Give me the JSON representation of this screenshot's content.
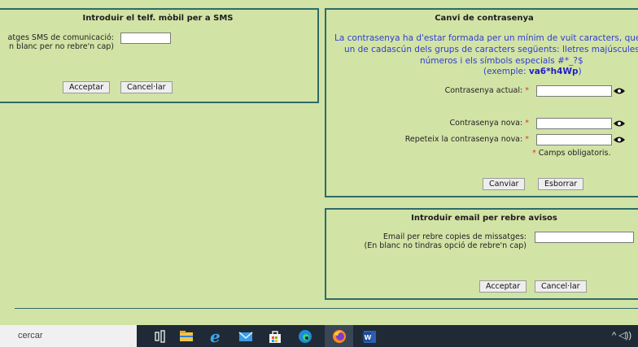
{
  "sms": {
    "title": "Introduir el telf. mòbil per a SMS",
    "field_label_line1": "atges SMS de comunicació:",
    "field_label_line2": "n blanc per no rebre'n cap)",
    "field_value": "",
    "accept_label": "Acceptar",
    "cancel_label": "Cancel·lar"
  },
  "password": {
    "title": "Canvi de contrasenya",
    "info_line1": "La contrasenya ha d'estar formada per un mínim de vuit caracters, que co",
    "info_line2": "un de cadascún dels grups de caracters següents: lletres majúscules,",
    "info_line3": "números i els símbols especials #*_?$",
    "info_example_prefix": "(exemple: ",
    "info_example_value": "va6*h4Wp",
    "info_example_suffix": ")",
    "current_label": "Contrasenya actual:",
    "new_label": "Contrasenya nova:",
    "repeat_label": "Repeteix la contrasenya nova:",
    "required_marker": "*",
    "required_note": "Camps obligatoris.",
    "change_label": "Canviar",
    "clear_label": "Esborrar"
  },
  "email": {
    "title": "Introduir email per rebre avisos",
    "field_label_line1": "Email per rebre copies de missatges:",
    "field_label_line2": "(En blanc no tindras opció de rebre'n cap)",
    "field_value": "",
    "accept_label": "Acceptar",
    "cancel_label": "Cancel·lar"
  },
  "taskbar": {
    "search_text": "cercar",
    "icons": [
      "task-view-icon",
      "file-explorer-icon",
      "edge-legacy-icon",
      "mail-icon",
      "store-icon",
      "edge-icon",
      "firefox-icon",
      "word-icon"
    ],
    "tray_text": "^ ◁))"
  },
  "colors": {
    "page_bg": "#d2e3a6",
    "panel_border": "#2e6b69",
    "info_text": "#2f3ed0",
    "required": "#d23b2c",
    "taskbar_bg": "#1f2a36"
  }
}
